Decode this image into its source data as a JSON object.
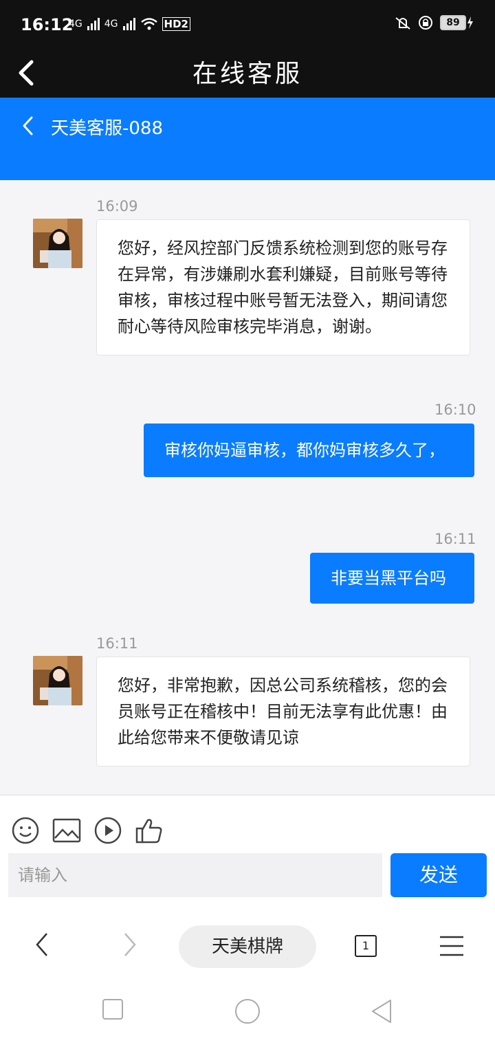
{
  "status": {
    "time": "16:12",
    "left_icons": [
      "4G",
      "4G"
    ],
    "hd": "HD2",
    "battery": "89"
  },
  "titlebar": {
    "title": "在线客服"
  },
  "chat_header": {
    "name": "天美客服-088"
  },
  "messages": [
    {
      "time": "16:09",
      "from": "agent",
      "text": "您好，经风控部门反馈系统检测到您的账号存在异常，有涉嫌刷水套利嫌疑，目前账号等待审核，审核过程中账号暂无法登入，期间请您耐心等待风险审核完毕消息，谢谢。"
    },
    {
      "time": "16:10",
      "from": "user",
      "text": "审核你妈逼审核，都你妈审核多久了，"
    },
    {
      "time": "16:11",
      "from": "user",
      "text": "非要当黑平台吗"
    },
    {
      "time": "16:11",
      "from": "agent",
      "text": "您好，非常抱歉，因总公司系统稽核，您的会员账号正在稽核中！目前无法享有此优惠！由此给您带来不便敬请见谅"
    }
  ],
  "composer": {
    "placeholder": "请输入",
    "send_label": "发送"
  },
  "browser": {
    "site_label": "天美棋牌",
    "tab_count": "1"
  },
  "colors": {
    "accent": "#0a7cff",
    "bar": "#111111"
  }
}
